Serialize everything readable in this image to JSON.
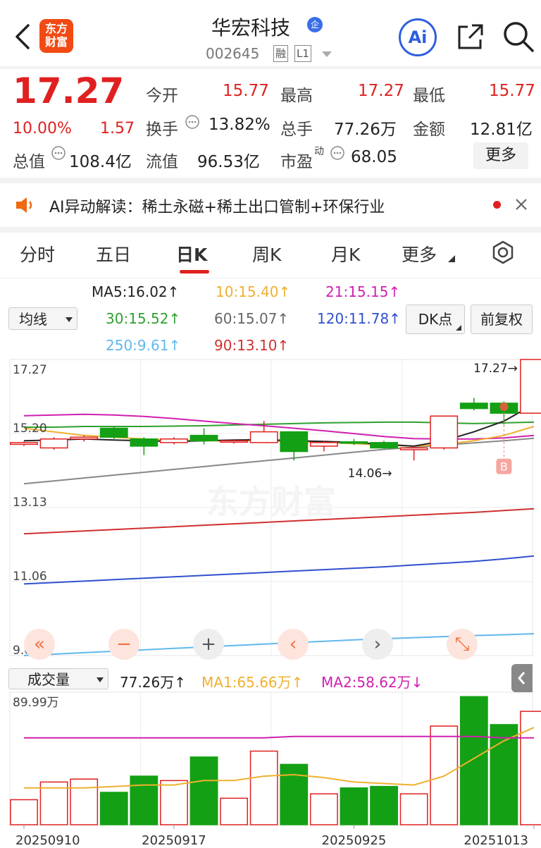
{
  "header": {
    "logo_line1": "东方",
    "logo_line2": "财富",
    "stock_name": "华宏科技",
    "enterprise_badge": "企",
    "stock_code": "002645",
    "tag_margin": "融",
    "tag_level": "L1",
    "ai_label": "Ai"
  },
  "quote": {
    "price": "17.27",
    "change_pct": "10.00%",
    "change_amt": "1.57",
    "open_label": "今开",
    "open": "15.77",
    "high_label": "最高",
    "high": "17.27",
    "low_label": "最低",
    "low": "15.77",
    "turnover_label": "换手",
    "turnover": "13.82%",
    "volume_label": "总手",
    "volume": "77.26万",
    "amount_label": "金额",
    "amount": "12.81亿",
    "mktcap_label": "总值",
    "mktcap": "108.4亿",
    "float_label": "流值",
    "float_cap": "96.53亿",
    "pe_label": "市盈",
    "pe_sup": "动",
    "pe": "68.05",
    "more_label": "更多"
  },
  "ai_bar": {
    "text": "AI异动解读：稀土永磁+稀土出口管制+环保行业"
  },
  "tabs": [
    "分时",
    "五日",
    "日K",
    "周K",
    "月K",
    "更多"
  ],
  "indicators": {
    "selector_label": "均线",
    "ma5": "MA5:16.02",
    "ma10": "10:15.40",
    "ma21": "21:15.15",
    "ma30": "30:15.52",
    "ma60": "60:15.07",
    "ma120": "120:11.78",
    "ma250": "250:9.61",
    "ma90": "90:13.10",
    "dk_label": "DK点",
    "fq_label": "前复权"
  },
  "colors": {
    "up": "#e02020",
    "down": "#14a014",
    "ma5": "#222222",
    "ma10": "#f0b030",
    "ma21": "#d020b0",
    "ma30": "#30a030",
    "ma60": "#888888",
    "ma120": "#3050d0",
    "ma250": "#60b8ee",
    "ma90": "#d03030"
  },
  "kchart": {
    "y_labels": [
      "17.27",
      "15.20",
      "13.13",
      "11.06",
      "9.00"
    ],
    "annotation_high": "17.27",
    "annotation_low": "14.06",
    "signal_label": "B",
    "watermark": "东方财富",
    "candles": [
      {
        "o": 14.9,
        "c": 14.95,
        "h": 14.98,
        "l": 14.85
      },
      {
        "o": 14.8,
        "c": 15.05,
        "h": 15.1,
        "l": 14.75
      },
      {
        "o": 15.05,
        "c": 15.1,
        "h": 15.15,
        "l": 14.98
      },
      {
        "o": 15.35,
        "c": 15.1,
        "h": 15.4,
        "l": 15.05
      },
      {
        "o": 15.05,
        "c": 14.85,
        "h": 15.1,
        "l": 14.6
      },
      {
        "o": 14.95,
        "c": 15.05,
        "h": 15.1,
        "l": 14.9
      },
      {
        "o": 15.15,
        "c": 15.0,
        "h": 15.35,
        "l": 14.9
      },
      {
        "o": 15.0,
        "c": 15.0,
        "h": 15.05,
        "l": 14.92
      },
      {
        "o": 14.95,
        "c": 15.25,
        "h": 15.55,
        "l": 14.95
      },
      {
        "o": 15.25,
        "c": 14.7,
        "h": 15.25,
        "l": 14.45
      },
      {
        "o": 14.85,
        "c": 14.95,
        "h": 15.0,
        "l": 14.7
      },
      {
        "o": 14.97,
        "c": 14.94,
        "h": 15.05,
        "l": 14.88
      },
      {
        "o": 14.95,
        "c": 14.8,
        "h": 15.0,
        "l": 14.78
      },
      {
        "o": 14.75,
        "c": 14.8,
        "h": 14.85,
        "l": 14.45
      },
      {
        "o": 14.8,
        "c": 15.69,
        "h": 15.69,
        "l": 14.75
      },
      {
        "o": 16.05,
        "c": 15.9,
        "h": 16.2,
        "l": 15.85
      },
      {
        "o": 16.05,
        "c": 15.77,
        "h": 16.1,
        "l": 15.45
      },
      {
        "o": 15.77,
        "c": 17.27,
        "h": 17.27,
        "l": 15.77
      }
    ],
    "ma_lines": {
      "ma5": [
        15.0,
        15.02,
        15.05,
        15.02,
        15.0,
        14.98,
        15.0,
        15.02,
        15.03,
        15.0,
        14.98,
        14.95,
        14.9,
        14.85,
        15.0,
        15.25,
        15.55,
        16.02
      ],
      "ma10": [
        15.35,
        15.25,
        15.15,
        15.1,
        15.05,
        15.02,
        15.0,
        15.0,
        15.0,
        14.98,
        14.95,
        14.92,
        14.88,
        14.85,
        14.9,
        15.0,
        15.15,
        15.4
      ],
      "ma21": [
        15.7,
        15.72,
        15.74,
        15.72,
        15.68,
        15.62,
        15.55,
        15.48,
        15.42,
        15.35,
        15.28,
        15.2,
        15.12,
        15.06,
        15.05,
        15.05,
        15.08,
        15.15
      ],
      "ma30": [
        15.38,
        15.38,
        15.4,
        15.4,
        15.4,
        15.41,
        15.42,
        15.44,
        15.46,
        15.48,
        15.5,
        15.51,
        15.52,
        15.52,
        15.5,
        15.48,
        15.5,
        15.52
      ],
      "ma60": [
        13.8,
        13.88,
        13.96,
        14.04,
        14.12,
        14.2,
        14.28,
        14.36,
        14.44,
        14.52,
        14.6,
        14.68,
        14.76,
        14.82,
        14.88,
        14.94,
        15.0,
        15.07
      ],
      "ma90": [
        12.4,
        12.44,
        12.48,
        12.52,
        12.56,
        12.6,
        12.64,
        12.68,
        12.72,
        12.76,
        12.8,
        12.84,
        12.88,
        12.92,
        12.96,
        13.0,
        13.05,
        13.1
      ],
      "ma120": [
        11.0,
        11.04,
        11.08,
        11.12,
        11.16,
        11.2,
        11.24,
        11.28,
        11.32,
        11.36,
        11.4,
        11.44,
        11.48,
        11.53,
        11.58,
        11.63,
        11.7,
        11.78
      ],
      "ma250": [
        9.0,
        9.04,
        9.08,
        9.12,
        9.16,
        9.2,
        9.24,
        9.28,
        9.32,
        9.36,
        9.4,
        9.44,
        9.47,
        9.5,
        9.53,
        9.56,
        9.58,
        9.61
      ]
    },
    "y_min": 9.0,
    "y_max": 17.27
  },
  "volume": {
    "selector_label": "成交量",
    "current": "77.26万",
    "ma1": "MA1:65.66万",
    "ma2": "MA2:58.62万",
    "y_label": "89.99万",
    "y_max": 89.99,
    "values": [
      17,
      29,
      31,
      22,
      33,
      30,
      46,
      18,
      50,
      41,
      21,
      25,
      26,
      21,
      67,
      87,
      68,
      77
    ],
    "ma1_line": [
      25,
      25,
      25,
      26,
      27,
      27,
      30,
      30,
      33,
      34,
      32,
      29,
      28,
      27,
      33,
      45,
      57,
      66
    ],
    "ma2_line": [
      59,
      59,
      59,
      59,
      59,
      59,
      59,
      59,
      59,
      60,
      60,
      60,
      60,
      60,
      60,
      60,
      59,
      59
    ],
    "x_labels": [
      "20250910",
      "20250917",
      "20250925",
      "20251013"
    ]
  }
}
